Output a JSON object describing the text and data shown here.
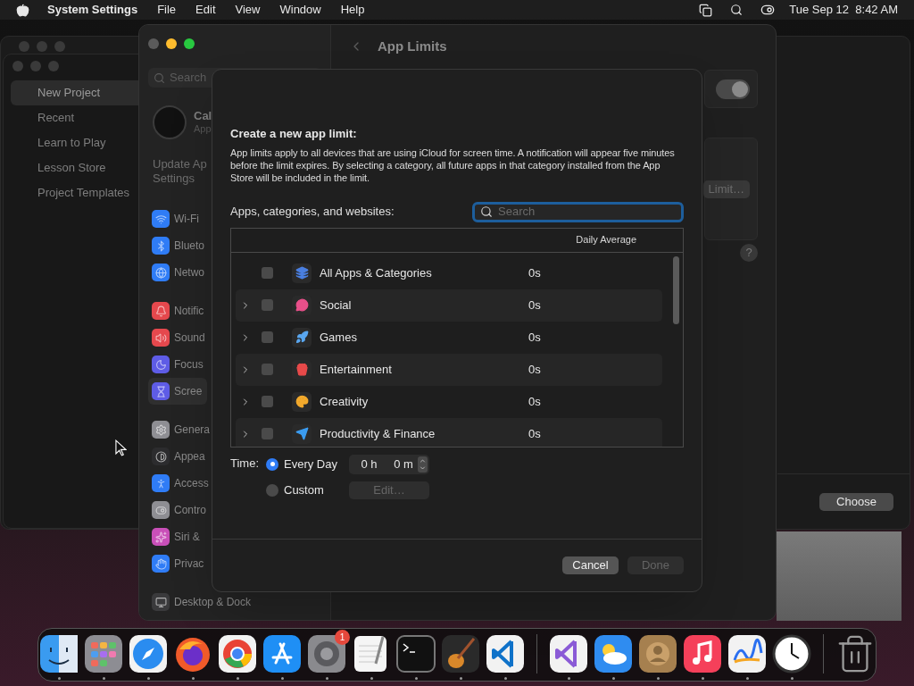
{
  "menubar": {
    "app": "System Settings",
    "menus": [
      "File",
      "Edit",
      "View",
      "Window",
      "Help"
    ],
    "clock": "Tue Sep 12  8:42 AM"
  },
  "back_window": {
    "sidebar": [
      {
        "label": "New Project",
        "selected": true
      },
      {
        "label": "Recent",
        "selected": false
      },
      {
        "label": "Learn to Play",
        "selected": false
      },
      {
        "label": "Lesson Store",
        "selected": false
      },
      {
        "label": "Project Templates",
        "selected": false
      }
    ],
    "choose_button": "Choose"
  },
  "settings_window": {
    "title": "App Limits",
    "search_placeholder": "Search",
    "profile": {
      "name": "Cal",
      "subtitle": "App"
    },
    "notice_lines": [
      "Update Ap",
      "Settings"
    ],
    "sidebar_groups": [
      [
        {
          "label": "Wi-Fi",
          "color": "#2f7cf6",
          "selected": false
        },
        {
          "label": "Blueto",
          "color": "#2f7cf6",
          "selected": false
        },
        {
          "label": "Netwo",
          "color": "#2f7cf6",
          "selected": false
        }
      ],
      [
        {
          "label": "Notific",
          "color": "#e5484d",
          "selected": false
        },
        {
          "label": "Sound",
          "color": "#e5484d",
          "selected": false
        },
        {
          "label": "Focus",
          "color": "#5e5ce6",
          "selected": false
        },
        {
          "label": "Scree",
          "color": "#5e5ce6",
          "selected": true
        }
      ],
      [
        {
          "label": "Genera",
          "color": "#8e8e93",
          "selected": false
        },
        {
          "label": "Appea",
          "color": "#2c2c2e",
          "selected": false
        },
        {
          "label": "Access",
          "color": "#2f7cf6",
          "selected": false
        },
        {
          "label": "Contro",
          "color": "#8e8e93",
          "selected": false
        },
        {
          "label": "Siri &",
          "color": "#c94fb8",
          "selected": false
        },
        {
          "label": "Privac",
          "color": "#2f7cf6",
          "selected": false
        }
      ],
      [
        {
          "label": "Desktop & Dock",
          "color": "#3a3a3c",
          "selected": false
        }
      ]
    ],
    "toggle": {
      "on": true
    },
    "limit_button": "Limit…",
    "help_button": "?"
  },
  "dialog": {
    "heading": "Create a new app limit:",
    "description": "App limits apply to all devices that are using iCloud for screen time. A notification will appear five minutes before the limit expires. By selecting a category, all future apps in that category installed from the App Store will be included in the limit.",
    "list_label": "Apps, categories, and websites:",
    "search": {
      "placeholder": "Search"
    },
    "column": "Daily Average",
    "rows": [
      {
        "name": "All Apps & Categories",
        "daily_average": "0s",
        "expandable": false,
        "checked": false,
        "color": "#4a7fe0"
      },
      {
        "name": "Social",
        "daily_average": "0s",
        "expandable": true,
        "checked": false,
        "color": "#e8508a"
      },
      {
        "name": "Games",
        "daily_average": "0s",
        "expandable": true,
        "checked": false,
        "color": "#5aa7f0"
      },
      {
        "name": "Entertainment",
        "daily_average": "0s",
        "expandable": true,
        "checked": false,
        "color": "#e84a4a"
      },
      {
        "name": "Creativity",
        "daily_average": "0s",
        "expandable": true,
        "checked": false,
        "color": "#f2a92c"
      },
      {
        "name": "Productivity & Finance",
        "daily_average": "0s",
        "expandable": true,
        "checked": false,
        "color": "#3b9cf0"
      }
    ],
    "time": {
      "label": "Time:",
      "options": [
        {
          "label": "Every Day",
          "selected": true
        },
        {
          "label": "Custom",
          "selected": false
        }
      ],
      "hours": "0 h",
      "minutes": "0 m",
      "edit_button": {
        "label": "Edit…",
        "disabled": true
      }
    },
    "buttons": [
      {
        "label": "Cancel",
        "disabled": false
      },
      {
        "label": "Done",
        "disabled": true
      }
    ]
  },
  "dock": {
    "groups": [
      [
        {
          "running": true
        },
        {
          "running": true
        },
        {
          "running": true
        },
        {
          "running": true
        },
        {
          "running": true
        },
        {
          "running": true
        },
        {
          "running": true,
          "badge": "1"
        },
        {
          "running": true
        },
        {
          "running": true
        },
        {
          "running": true
        },
        {
          "running": true
        }
      ],
      [
        {
          "running": true
        },
        {
          "running": true
        },
        {
          "running": true
        },
        {
          "running": true
        },
        {
          "running": true
        },
        {
          "running": true
        }
      ]
    ],
    "trash": {
      "running": false
    }
  }
}
